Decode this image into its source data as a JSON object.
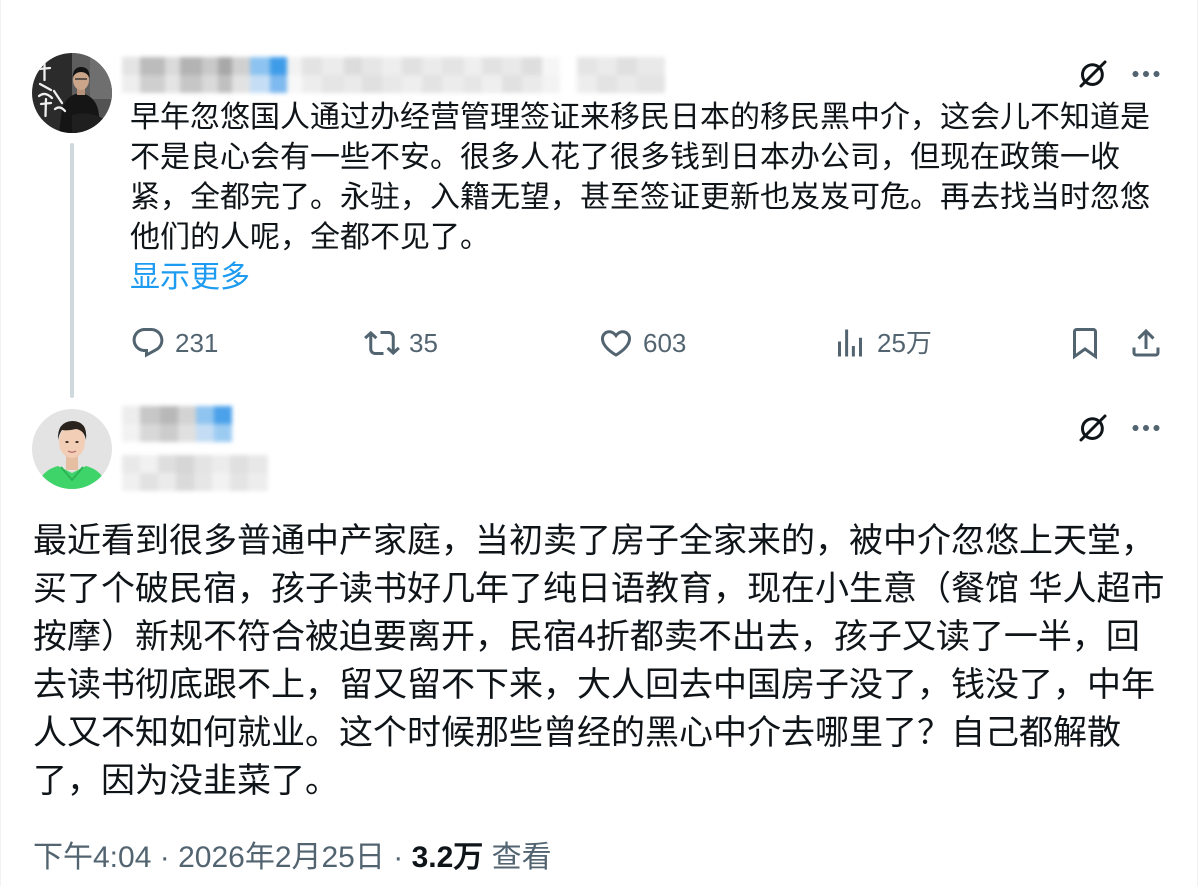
{
  "colors": {
    "background": "#ffffff",
    "text": "#0f1419",
    "secondary": "#536471",
    "link": "#1d9bf0",
    "thread_line": "#cfd9de"
  },
  "thread": {
    "parent_tweet": {
      "grok_icon": "grok-icon",
      "more_icon": "more-icon",
      "text_lines": [
        "早年忽悠国人通过办经营管理签证来移民日本的移民黑中介，这会儿不知道是",
        "不是良心会有一些不安。很多人花了很多钱到日本办公司，但现在政策一收",
        "紧，全都完了。永驻，入籍无望，甚至签证更新也岌岌可危。再去找当时忽悠",
        "他们的人呢，全都不见了。"
      ],
      "show_more_label": "显示更多",
      "actions": {
        "reply": {
          "icon": "reply-icon",
          "count": "231"
        },
        "retweet": {
          "icon": "retweet-icon",
          "count": "35"
        },
        "like": {
          "icon": "like-icon",
          "count": "603"
        },
        "views": {
          "icon": "views-icon",
          "count": "25万"
        },
        "bookmark": {
          "icon": "bookmark-icon"
        },
        "share": {
          "icon": "share-icon"
        }
      }
    },
    "main_tweet": {
      "grok_icon": "grok-icon",
      "more_icon": "more-icon",
      "text_lines": [
        "最近看到很多普通中产家庭，当初卖了房子全家来的，被中介忽悠上天堂，",
        "买了个破民宿，孩子读书好几年了纯日语教育，现在小生意（餐馆 华人超市",
        "按摩）新规不符合被迫要离开，民宿4折都卖不出去，孩子又读了一半，回",
        "去读书彻底跟不上，留又留不下来，大人回去中国房子没了，钱没了，中年",
        "人又不知如何就业。这个时候那些曾经的黑心中介去哪里了？自己都解散",
        "了，因为没韭菜了。"
      ],
      "timestamp": {
        "time": "下午4:04",
        "separator": "·",
        "date": "2026年2月25日",
        "views_count": "3.2万",
        "views_label": "查看"
      }
    }
  }
}
